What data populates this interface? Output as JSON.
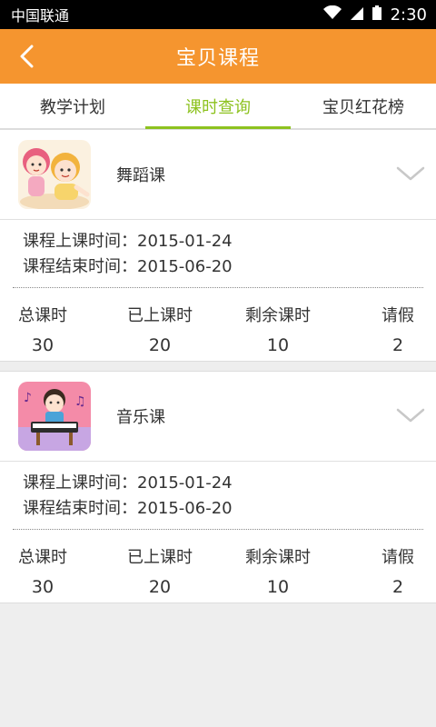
{
  "status": {
    "carrier": "中国联通",
    "time": "2:30"
  },
  "header": {
    "title": "宝贝课程"
  },
  "tabs": [
    {
      "label": "教学计划",
      "active": false
    },
    {
      "label": "课时查询",
      "active": true
    },
    {
      "label": "宝贝红花榜",
      "active": false
    }
  ],
  "courses": [
    {
      "name": "舞蹈课",
      "icon": "dance-girls-icon",
      "start_label": "课程上课时间：",
      "start": "2015-01-24",
      "end_label": "课程结束时间：",
      "end": "2015-06-20",
      "stats": [
        {
          "label": "总课时",
          "value": "30"
        },
        {
          "label": "已上课时",
          "value": "20"
        },
        {
          "label": "剩余课时",
          "value": "10"
        },
        {
          "label": "请假",
          "value": "2"
        }
      ]
    },
    {
      "name": "音乐课",
      "icon": "piano-boy-icon",
      "start_label": "课程上课时间：",
      "start": "2015-01-24",
      "end_label": "课程结束时间：",
      "end": "2015-06-20",
      "stats": [
        {
          "label": "总课时",
          "value": "30"
        },
        {
          "label": "已上课时",
          "value": "20"
        },
        {
          "label": "剩余课时",
          "value": "10"
        },
        {
          "label": "请假",
          "value": "2"
        }
      ]
    }
  ],
  "colors": {
    "accent": "#f5952f",
    "tab_active": "#8dc21f",
    "background": "#eeeeee"
  }
}
